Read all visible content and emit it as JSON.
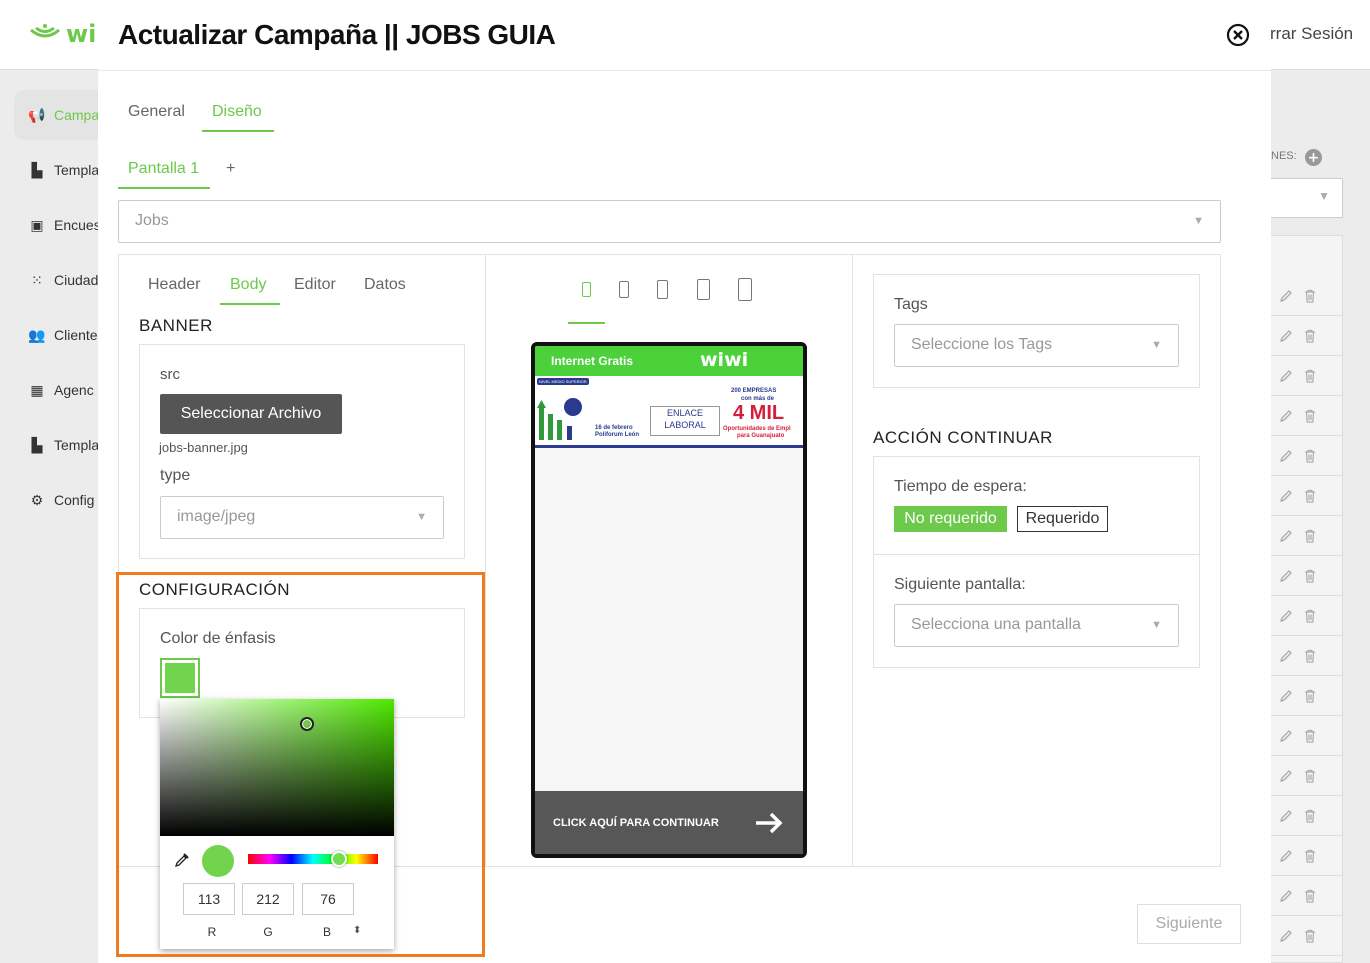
{
  "background": {
    "logo_text": "wi",
    "logout_label": "rrar Sesión",
    "sidebar": [
      {
        "label": "Campa",
        "icon": "megaphone-icon"
      },
      {
        "label": "Templa",
        "icon": "template-icon"
      },
      {
        "label": "Encues",
        "icon": "clipboard-icon"
      },
      {
        "label": "Ciudad",
        "icon": "grid-dots-icon"
      },
      {
        "label": "Cliente",
        "icon": "users-icon"
      },
      {
        "label": "Agenc",
        "icon": "building-icon"
      },
      {
        "label": "Templa",
        "icon": "template-icon"
      },
      {
        "label": "Config",
        "icon": "gear-icon"
      }
    ],
    "right_label": "NES:"
  },
  "modal": {
    "title": "Actualizar Campaña || JOBS GUIA",
    "tabs": [
      "General",
      "Diseño"
    ],
    "active_tab": "Diseño",
    "screen_tab": "Pantalla 1",
    "add_screen": "+",
    "template_select": "Jobs",
    "subtabs": [
      "Header",
      "Body",
      "Editor",
      "Datos"
    ],
    "active_subtab": "Body",
    "banner": {
      "section_title": "BANNER",
      "src_label": "src",
      "select_file_button": "Seleccionar Archivo",
      "filename": "jobs-banner.jpg",
      "type_label": "type",
      "type_value": "image/jpeg"
    },
    "config": {
      "section_title": "CONFIGURACIÓN",
      "emphasis_label": "Color de énfasis",
      "color_hex": "#71d44c",
      "rgb": {
        "r": "113",
        "g": "212",
        "b": "76"
      },
      "rgb_labels": {
        "r": "R",
        "g": "G",
        "b": "B"
      }
    },
    "preview": {
      "header_text": "Internet Gratis",
      "logo_text": "wiwi",
      "banner_badge": "NIVEL MEDIO SUPERIOR",
      "banner_date": "16 de febrero",
      "banner_place": "Poliforum León",
      "banner_enlace": "ENLACE LABORAL",
      "banner_empresas": "200 EMPRESAS",
      "banner_conmas": "con más de",
      "banner_big": "4 MIL",
      "banner_oportunidades": "Oportunidades de Empl",
      "banner_para": "para Guanajuato",
      "continue_text": "CLICK AQUÍ PARA CONTINUAR"
    },
    "tags": {
      "label": "Tags",
      "placeholder": "Seleccione los Tags"
    },
    "action": {
      "section_title": "ACCIÓN CONTINUAR",
      "wait_label": "Tiempo de espera:",
      "btn_not_required": "No requerido",
      "btn_required": "Requerido",
      "next_screen_label": "Siguiente pantalla:",
      "next_screen_placeholder": "Selecciona una pantalla"
    },
    "next_button": "Siguiente"
  },
  "colors": {
    "accent": "#6cc94a",
    "highlight": "#f07a1e",
    "phone_header": "#4cd13a"
  }
}
